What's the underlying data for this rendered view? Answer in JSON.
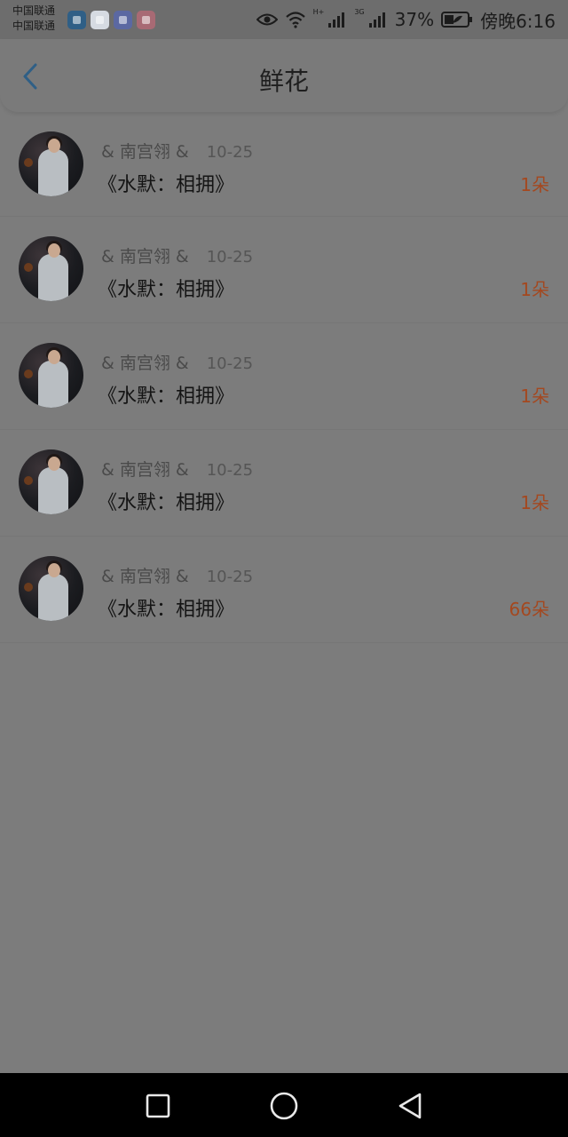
{
  "status_bar": {
    "carrier_1": "中国联通",
    "carrier_2": "中国联通",
    "network_label": "H+",
    "network_label_2": "3G",
    "battery_percent": "37%",
    "time": "傍晚6:16"
  },
  "header": {
    "title": "鲜花",
    "back_icon": "chevron-left-icon",
    "accent_color": "#2f5f86"
  },
  "records": [
    {
      "user": "& 南宫翎 &",
      "date": "10-25",
      "book": "《水默：相拥》",
      "flowers": "1朵"
    },
    {
      "user": "& 南宫翎 &",
      "date": "10-25",
      "book": "《水默：相拥》",
      "flowers": "1朵"
    },
    {
      "user": "& 南宫翎 &",
      "date": "10-25",
      "book": "《水默：相拥》",
      "flowers": "1朵"
    },
    {
      "user": "& 南宫翎 &",
      "date": "10-25",
      "book": "《水默：相拥》",
      "flowers": "1朵"
    },
    {
      "user": "& 南宫翎 &",
      "date": "10-25",
      "book": "《水默：相拥》",
      "flowers": "66朵"
    }
  ],
  "nav": {
    "recent_icon": "square-icon",
    "home_icon": "circle-icon",
    "back_icon": "triangle-back-icon"
  }
}
